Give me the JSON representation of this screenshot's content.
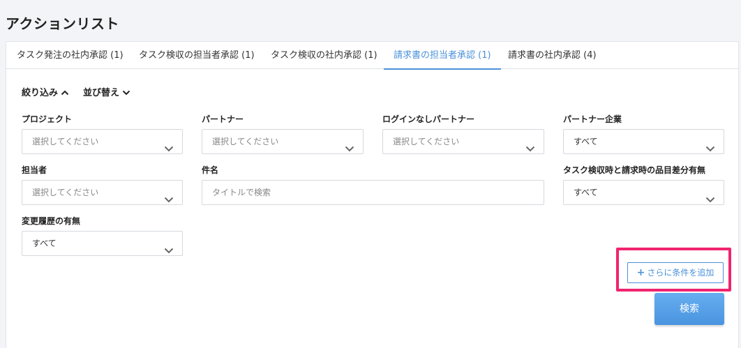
{
  "page": {
    "title": "アクションリスト"
  },
  "tabs": [
    {
      "label": "タスク発注の社内承認 (1)",
      "active": false
    },
    {
      "label": "タスク検収の担当者承認 (1)",
      "active": false
    },
    {
      "label": "タスク検収の社内承認 (1)",
      "active": false
    },
    {
      "label": "請求書の担当者承認 (1)",
      "active": true
    },
    {
      "label": "請求書の社内承認 (4)",
      "active": false
    }
  ],
  "controls": {
    "filter_label": "絞り込み",
    "sort_label": "並び替え"
  },
  "filters": {
    "project": {
      "label": "プロジェクト",
      "placeholder": "選択してください"
    },
    "partner": {
      "label": "パートナー",
      "placeholder": "選択してください"
    },
    "login_less_partner": {
      "label": "ログインなしパートナー",
      "placeholder": "選択してください"
    },
    "partner_company": {
      "label": "パートナー企業",
      "value": "すべて"
    },
    "assignee": {
      "label": "担当者",
      "placeholder": "選択してください"
    },
    "subject": {
      "label": "件名",
      "placeholder": "タイトルで検索"
    },
    "item_diff": {
      "label": "タスク検収時と請求時の品目差分有無",
      "value": "すべて"
    },
    "change_history": {
      "label": "変更履歴の有無",
      "value": "すべて"
    }
  },
  "actions": {
    "add_condition": "さらに条件を追加",
    "search": "検索"
  },
  "colors": {
    "accent": "#4a90d9",
    "highlight": "#f0246e"
  }
}
